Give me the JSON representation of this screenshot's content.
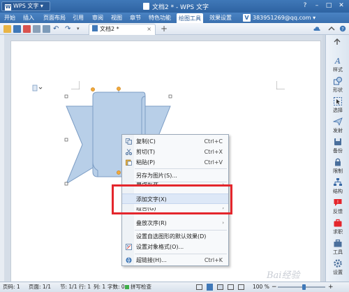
{
  "titlebar": {
    "app_label": "WPS 文字",
    "app_logo_letter": "W",
    "window_title": "文档2 * - WPS 文字",
    "controls": [
      "?",
      "–",
      "□",
      "✕"
    ]
  },
  "menubar": {
    "items": [
      "开始",
      "插入",
      "页面布局",
      "引用",
      "审阅",
      "视图",
      "章节",
      "特色功能",
      "绘图工具",
      "效果设置"
    ],
    "active_index": 8,
    "account": "383951269@qq.com"
  },
  "tabs": {
    "doc_tab": "文档2 *",
    "close": "×",
    "new_tab": "+"
  },
  "context_menu": {
    "items": [
      {
        "label": "复制(C)",
        "shortcut": "Ctrl+C",
        "icon": "copy-icon"
      },
      {
        "label": "剪切(T)",
        "shortcut": "Ctrl+X",
        "icon": "cut-icon"
      },
      {
        "label": "粘贴(P)",
        "shortcut": "Ctrl+V",
        "icon": "paste-icon"
      },
      {
        "label": "另存为图片(S)...",
        "shortcut": "",
        "icon": ""
      },
      {
        "label": "更改形状",
        "shortcut": "",
        "icon": "",
        "submenu": true
      },
      {
        "label": "添加文字(X)",
        "shortcut": "",
        "icon": "",
        "highlighted": true
      },
      {
        "label": "组合(G)",
        "shortcut": "",
        "icon": "",
        "submenu": true
      },
      {
        "label": "叠放次序(R)",
        "shortcut": "",
        "icon": "",
        "submenu": true
      },
      {
        "label": "设置自选图形的默认效果(D)",
        "shortcut": "",
        "icon": ""
      },
      {
        "label": "设置对象格式(O)...",
        "shortcut": "",
        "icon": "format-icon"
      },
      {
        "label": "超链接(H)...",
        "shortcut": "Ctrl+K",
        "icon": "hyperlink-icon"
      }
    ],
    "submenu_arrow": "›"
  },
  "rightbar": {
    "items": [
      "样式",
      "形状",
      "选择",
      "发射",
      "备份",
      "限制",
      "结构",
      "反馈",
      "求职",
      "工具",
      "设置"
    ]
  },
  "statusbar": {
    "page_no": "页码: 1",
    "pages": "页面: 1/1",
    "section": "节: 1/1",
    "row": "行: 1",
    "col": "列: 1",
    "words": "字数: 0",
    "spell": "拼写检查",
    "zoom": "100 %",
    "zoom_level": 0.55
  },
  "watermark": "Bai经验",
  "colors": {
    "accent": "#3f78b8",
    "shape_fill": "#b8cfe8",
    "shape_stroke": "#7b9cc4",
    "highlight_box": "#e4262c"
  }
}
